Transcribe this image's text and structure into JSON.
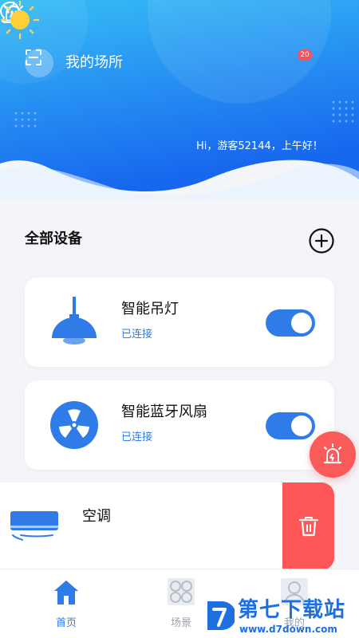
{
  "header": {
    "place_title": "我的场所",
    "alarm_badge": "20",
    "greeting": "Hi，游客52144，上午好！"
  },
  "devices_section": {
    "title": "全部设备"
  },
  "devices": [
    {
      "name": "智能吊灯",
      "status": "已连接",
      "icon": "pendant-lamp-icon",
      "enabled": true
    },
    {
      "name": "智能蓝牙风扇",
      "status": "已连接",
      "icon": "fan-icon",
      "enabled": true
    },
    {
      "name": "空调",
      "icon": "air-conditioner-icon"
    }
  ],
  "bottom_nav": {
    "items": [
      {
        "label": "首页",
        "icon": "home-icon",
        "active": true
      },
      {
        "label": "场景",
        "icon": "scene-icon",
        "active": false
      },
      {
        "label": "我的",
        "icon": "user-icon",
        "active": false
      }
    ]
  },
  "watermark": {
    "title": "第七下载站",
    "url": "www.d7down.com"
  },
  "colors": {
    "primary": "#2f7be8",
    "header_top": "#36b9f5",
    "header_bottom": "#1a6ff0",
    "danger": "#ff5757",
    "background": "#f3f5f8"
  }
}
